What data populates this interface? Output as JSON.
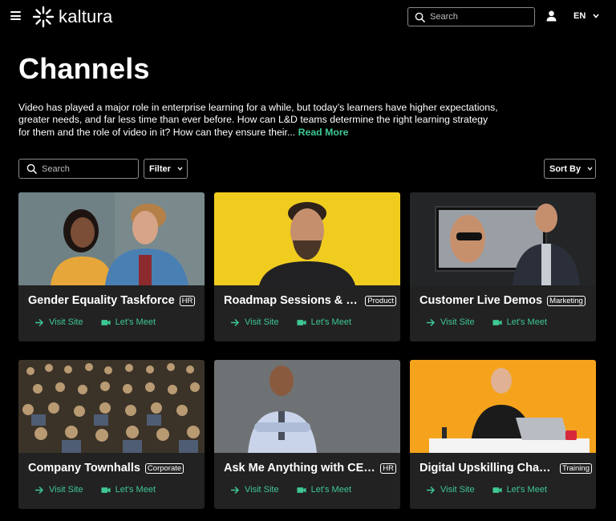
{
  "header": {
    "logo_text": "kaltura",
    "search_placeholder": "Search",
    "language": "EN",
    "colors": {
      "background": "#000000",
      "accent": "#3ec793"
    }
  },
  "page": {
    "title": "Channels",
    "description": "Video has played a major role in enterprise learning for a while, but today’s learners have higher expectations, greater needs, and far less time than ever before. How can L&D teams determine the right learning strategy for them and the role of video in it? How can they ensure their...",
    "read_more": "Read More"
  },
  "controls": {
    "search_placeholder": "Search",
    "filter_label": "Filter",
    "sort_label": "Sort By"
  },
  "cards": [
    {
      "title": "Gender Equality Taskforce",
      "tag": "HR",
      "visit": "Visit Site",
      "meet": "Let's Meet"
    },
    {
      "title": "Roadmap Sessions & Pr...",
      "tag": "Product",
      "visit": "Visit Site",
      "meet": "Let's Meet"
    },
    {
      "title": "Customer Live Demos",
      "tag": "Marketing",
      "visit": "Visit Site",
      "meet": "Let's Meet"
    },
    {
      "title": "Company Townhalls",
      "tag": "Corporate",
      "visit": "Visit Site",
      "meet": "Let's Meet"
    },
    {
      "title": "Ask Me Anything with CEO...",
      "tag": "HR",
      "visit": "Visit Site",
      "meet": "Let's Meet"
    },
    {
      "title": "Digital Upskilling Chan...",
      "tag": "Training",
      "visit": "Visit Site",
      "meet": "Let's Meet"
    }
  ]
}
